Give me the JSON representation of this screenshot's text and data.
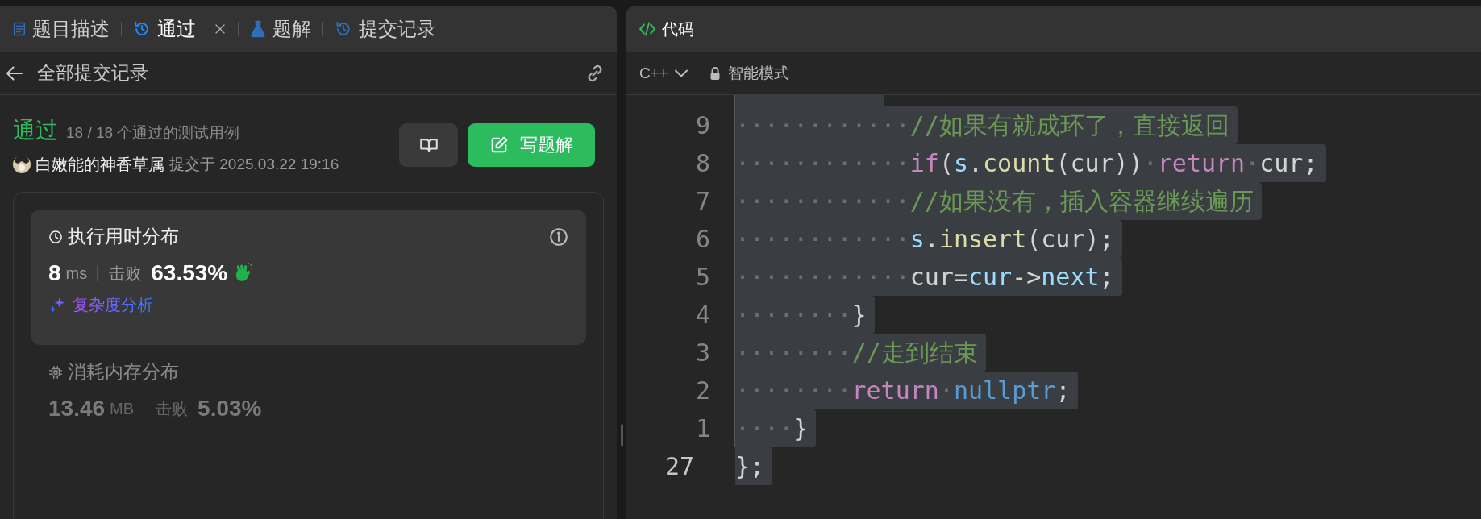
{
  "left_panel": {
    "tabs": [
      {
        "label": "题目描述",
        "kind": "document",
        "selected": false,
        "closable": false
      },
      {
        "label": "通过",
        "kind": "history",
        "selected": true,
        "closable": true
      },
      {
        "label": "题解",
        "kind": "flask",
        "selected": false,
        "closable": false
      },
      {
        "label": "提交记录",
        "kind": "history",
        "selected": false,
        "closable": false
      }
    ],
    "header": {
      "title": "全部提交记录"
    },
    "submission": {
      "status": "通过",
      "tests": "18 / 18 个通过的测试用例",
      "author": "白嫩能的神香草属",
      "submitted": "提交于 2025.03.22 19:16",
      "solution_button": "写题解"
    },
    "stats": [
      {
        "kind": "runtime",
        "title": "执行用时分布",
        "value": "8",
        "unit": "ms",
        "beat_label": "击败",
        "beat": "63.53%",
        "link": "复杂度分析",
        "selected": true
      },
      {
        "kind": "memory",
        "title": "消耗内存分布",
        "value": "13.46",
        "unit": "MB",
        "beat_label": "击败",
        "beat": "5.03%",
        "selected": false
      }
    ]
  },
  "editor": {
    "title": "代码",
    "language": "C++",
    "mode": "智能模式",
    "lines": [
      {
        "number": "9",
        "current": false,
        "selected": true,
        "tokens": [
          {
            "kind": "ws",
            "text": "············"
          },
          {
            "kind": "comment",
            "text": "//如果有就成环了，直接返回"
          }
        ]
      },
      {
        "number": "8",
        "current": false,
        "selected": true,
        "tokens": [
          {
            "kind": "ws",
            "text": "············"
          },
          {
            "kind": "keyword",
            "text": "if"
          },
          {
            "kind": "plain",
            "text": "("
          },
          {
            "kind": "var",
            "text": "s"
          },
          {
            "kind": "plain",
            "text": "."
          },
          {
            "kind": "func",
            "text": "count"
          },
          {
            "kind": "plain",
            "text": "(cur))"
          },
          {
            "kind": "ws",
            "text": "·"
          },
          {
            "kind": "keyword",
            "text": "return"
          },
          {
            "kind": "ws",
            "text": "·"
          },
          {
            "kind": "plain",
            "text": "cur;"
          }
        ]
      },
      {
        "number": "7",
        "current": false,
        "selected": true,
        "tokens": [
          {
            "kind": "ws",
            "text": "············"
          },
          {
            "kind": "comment",
            "text": "//如果没有，插入容器继续遍历"
          }
        ]
      },
      {
        "number": "6",
        "current": false,
        "selected": true,
        "tokens": [
          {
            "kind": "ws",
            "text": "············"
          },
          {
            "kind": "var",
            "text": "s"
          },
          {
            "kind": "plain",
            "text": "."
          },
          {
            "kind": "func",
            "text": "insert"
          },
          {
            "kind": "plain",
            "text": "(cur);"
          }
        ]
      },
      {
        "number": "5",
        "current": false,
        "selected": true,
        "tokens": [
          {
            "kind": "ws",
            "text": "············"
          },
          {
            "kind": "plain",
            "text": "cur="
          },
          {
            "kind": "var",
            "text": "cur"
          },
          {
            "kind": "plain",
            "text": "->"
          },
          {
            "kind": "var",
            "text": "next"
          },
          {
            "kind": "plain",
            "text": ";"
          }
        ]
      },
      {
        "number": "4",
        "current": false,
        "selected": true,
        "tokens": [
          {
            "kind": "ws",
            "text": "········"
          },
          {
            "kind": "plain",
            "text": "}"
          }
        ]
      },
      {
        "number": "3",
        "current": false,
        "selected": true,
        "tokens": [
          {
            "kind": "ws",
            "text": "········"
          },
          {
            "kind": "comment",
            "text": "//走到结束"
          }
        ]
      },
      {
        "number": "2",
        "current": false,
        "selected": true,
        "tokens": [
          {
            "kind": "ws",
            "text": "········"
          },
          {
            "kind": "keyword",
            "text": "return"
          },
          {
            "kind": "ws",
            "text": "·"
          },
          {
            "kind": "const",
            "text": "nullptr"
          },
          {
            "kind": "plain",
            "text": ";"
          }
        ]
      },
      {
        "number": "1",
        "current": false,
        "selected": true,
        "tokens": [
          {
            "kind": "ws",
            "text": "····"
          },
          {
            "kind": "plain",
            "text": "}"
          }
        ]
      },
      {
        "number": "27",
        "current": true,
        "selected": true,
        "tokens": [
          {
            "kind": "plain",
            "text": "};"
          }
        ]
      }
    ]
  }
}
